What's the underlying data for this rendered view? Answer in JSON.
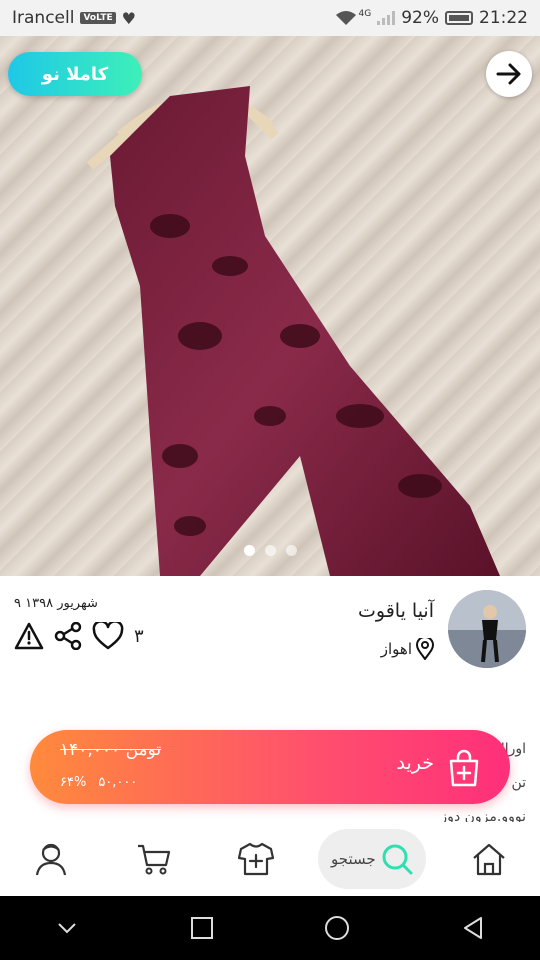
{
  "status_bar": {
    "carrier": "Irancell",
    "volte": "VoLTE",
    "network": "4G",
    "battery_percent": "92%",
    "time": "21:22"
  },
  "product": {
    "badge": "کاملا نو",
    "image_count": 3,
    "active_image": 3
  },
  "seller": {
    "name": "آنیا یاقوت",
    "location": "اهواز",
    "date": "۹ شهریور ۱۳۹۸",
    "likes": "۳"
  },
  "description_lines": [
    "اورال",
    "تن",
    "نووو.مزون دوز"
  ],
  "buy": {
    "label": "خرید",
    "old_price": "۱۴۰,۰۰۰ تومن",
    "new_price": "۵۰,۰۰۰",
    "discount": "۶۴%"
  },
  "bottom_nav": {
    "search_label": "جستجو",
    "items": [
      "profile",
      "cart",
      "add-product",
      "search",
      "home"
    ]
  },
  "colors": {
    "badge_gradient_start": "#1ec8e7",
    "badge_gradient_end": "#3df0b8",
    "buy_gradient_start": "#ff8a3c",
    "buy_gradient_end": "#ff2f7a",
    "search_icon": "#2ee0b0"
  }
}
